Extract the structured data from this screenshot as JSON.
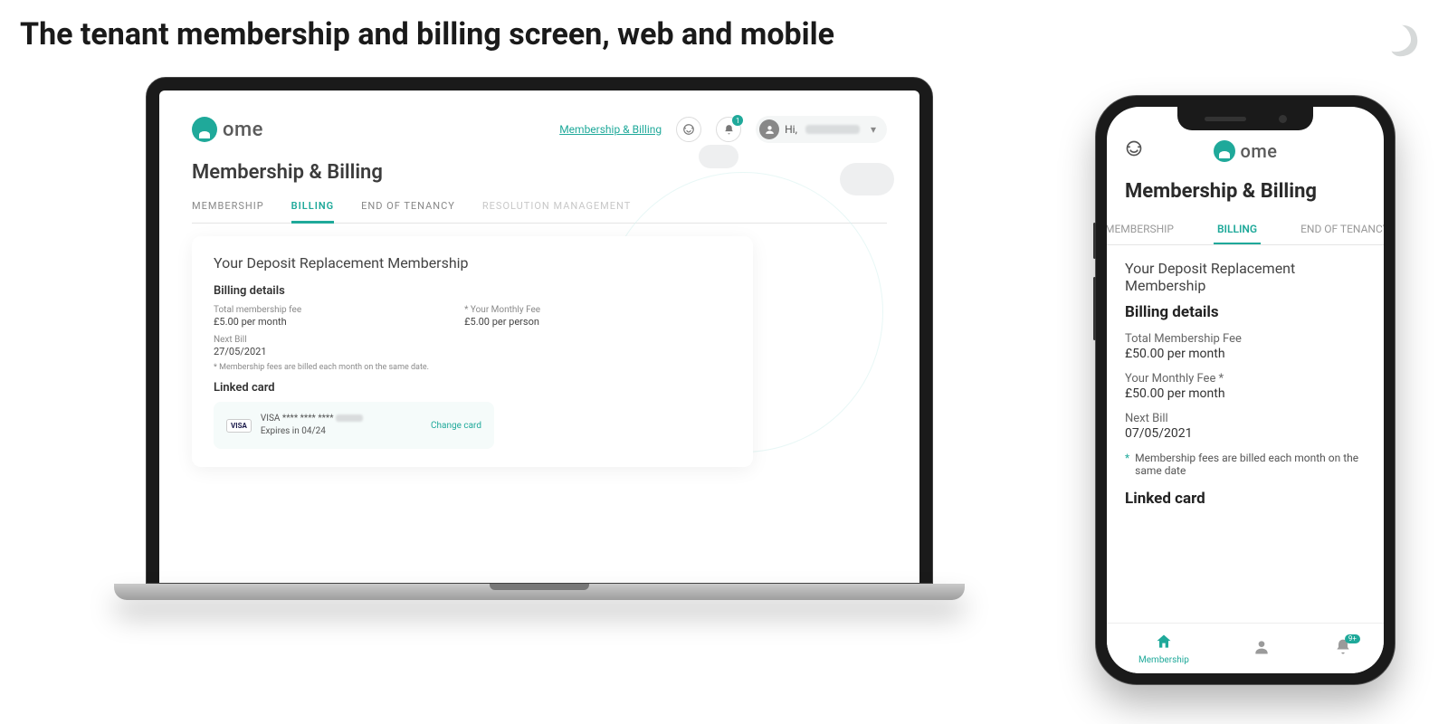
{
  "page": {
    "title": "The tenant membership and billing screen, web and mobile"
  },
  "brand": {
    "name": "ome",
    "accent": "#1fa99a"
  },
  "web": {
    "header": {
      "link_label": "Membership & Billing",
      "greeting_prefix": "Hi,",
      "notification_badge": "1"
    },
    "section_title": "Membership & Billing",
    "tabs": [
      {
        "label": "MEMBERSHIP",
        "active": false
      },
      {
        "label": "BILLING",
        "active": true
      },
      {
        "label": "END OF TENANCY",
        "active": false
      },
      {
        "label": "RESOLUTION MANAGEMENT",
        "active": false,
        "disabled": true
      }
    ],
    "card": {
      "title": "Your Deposit Replacement Membership",
      "billing_heading": "Billing details",
      "total_fee_label": "Total membership fee",
      "total_fee_value": "£5.00 per month",
      "monthly_fee_label": "* Your Monthly Fee",
      "monthly_fee_value": "£5.00 per person",
      "next_bill_label": "Next Bill",
      "next_bill_value": "27/05/2021",
      "note": "* Membership fees are billed each month on the same date.",
      "linked_card_heading": "Linked card",
      "card_brand": "VISA",
      "card_masked": "VISA **** **** ****",
      "card_expiry": "Expires in 04/24",
      "change_card_label": "Change card"
    }
  },
  "mobile": {
    "title": "Membership & Billing",
    "tabs": [
      {
        "label": "MEMBERSHIP",
        "active": false
      },
      {
        "label": "BILLING",
        "active": true
      },
      {
        "label": "END OF TENANCY",
        "active": false
      }
    ],
    "section_title": "Your Deposit Replacement Membership",
    "billing_heading": "Billing details",
    "total_fee_label": "Total Membership Fee",
    "total_fee_value": "£50.00 per month",
    "monthly_fee_label": "Your Monthly Fee *",
    "monthly_fee_value": "£50.00 per month",
    "next_bill_label": "Next Bill",
    "next_bill_value": "07/05/2021",
    "note": "Membership fees are billed each month on the same date",
    "linked_card_heading": "Linked card",
    "bottom_nav": {
      "home_label": "Membership",
      "notification_badge": "9+"
    }
  }
}
